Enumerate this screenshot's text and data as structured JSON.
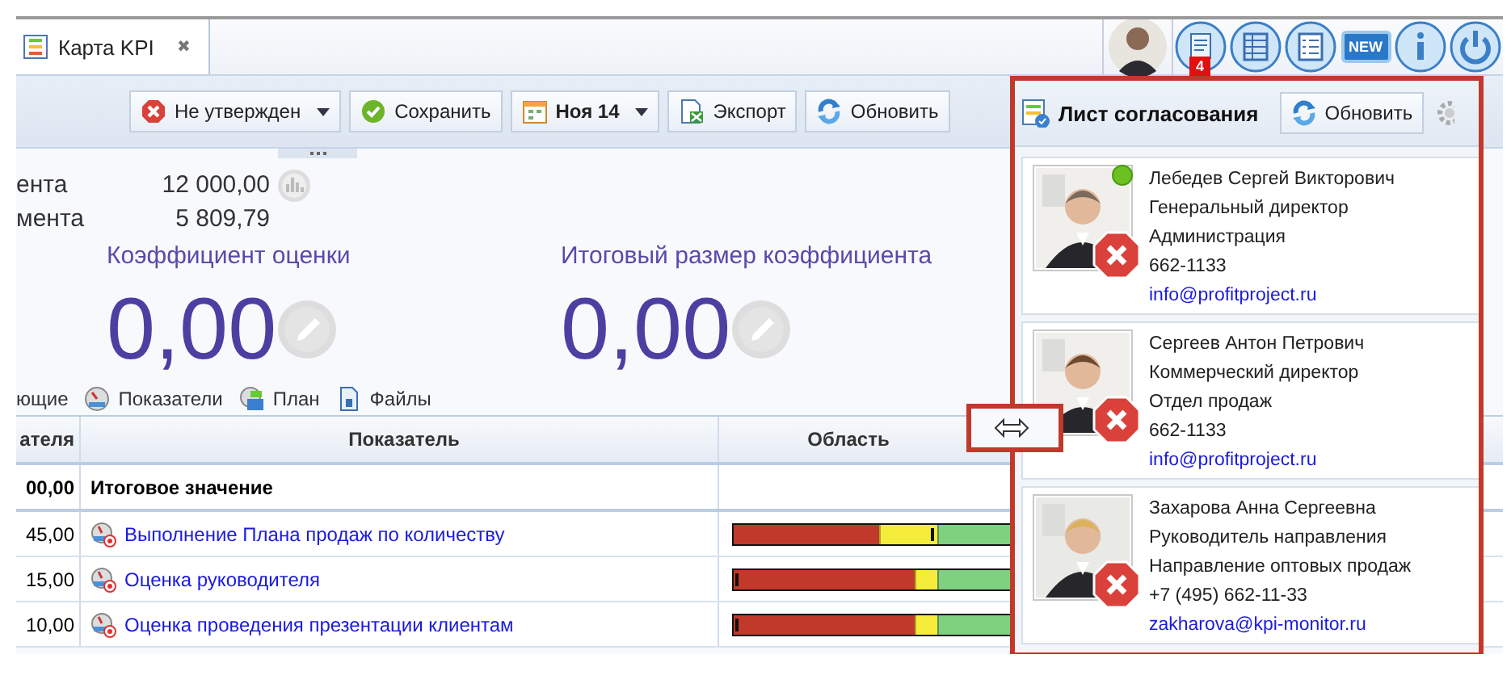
{
  "tab": {
    "label": "Карта KPI",
    "close": "✖",
    "selected": true
  },
  "header_icons": [
    {
      "kind": "avatar"
    },
    {
      "kind": "inbox",
      "badge": "4"
    },
    {
      "kind": "grid"
    },
    {
      "kind": "checklist"
    },
    {
      "kind": "new",
      "label": "NEW"
    },
    {
      "kind": "info"
    },
    {
      "kind": "power"
    }
  ],
  "toolbar": [
    {
      "kind": "rejected",
      "label": "Не утвержден",
      "dropdown": true
    },
    {
      "kind": "ok",
      "label": "Сохранить",
      "dropdown": false
    },
    {
      "kind": "calendar",
      "label": "Ноя 14",
      "dropdown": true
    },
    {
      "kind": "export",
      "label": "Экспорт",
      "dropdown": false
    },
    {
      "kind": "refresh",
      "label": "Обновить",
      "dropdown": false
    }
  ],
  "summary": [
    {
      "label": "ента",
      "value": "12 000,00",
      "chart_icon": true
    },
    {
      "label": "мента",
      "value": "5 809,79",
      "chart_icon": false
    }
  ],
  "scores": [
    {
      "title": "Коэффициент оценки",
      "value": "0,00"
    },
    {
      "title": "Итоговый размер коэффициента",
      "value": "0,00"
    }
  ],
  "sections": [
    {
      "label": "ющие",
      "kind": "none"
    },
    {
      "label": "Показатели",
      "kind": "gauge"
    },
    {
      "label": "План",
      "kind": "plan"
    },
    {
      "label": "Файлы",
      "kind": "file"
    }
  ],
  "table": {
    "columns": [
      "ателя",
      "Показатель",
      "Область"
    ],
    "rows": [
      {
        "kind": "total",
        "weight": "00,00",
        "name": "Итоговое значение"
      },
      {
        "kind": "indicator",
        "weight": "45,00",
        "name": "Выполнение Плана продаж по количеству",
        "marker": {
          "level": 0.61
        },
        "zones": [
          {
            "color": "#c0392b"
          },
          {
            "color": "#f6ec3a"
          },
          {
            "color": "#7fd07f"
          }
        ],
        "thresholds": [
          {
            "level": 0.45
          },
          {
            "level": 0.63
          }
        ]
      },
      {
        "kind": "indicator",
        "weight": "15,00",
        "name": "Оценка руководителя",
        "marker": {
          "level": 0.005
        },
        "zones": [
          {
            "color": "#c0392b"
          },
          {
            "color": "#f6ec3a"
          },
          {
            "color": "#7fd07f"
          }
        ],
        "thresholds": [
          {
            "level": 0.56
          },
          {
            "level": 0.63
          }
        ]
      },
      {
        "kind": "indicator",
        "weight": "10,00",
        "name": "Оценка проведения презентации клиентам",
        "marker": {
          "level": 0.005
        },
        "zones": [
          {
            "color": "#c0392b"
          },
          {
            "color": "#f6ec3a"
          },
          {
            "color": "#7fd07f"
          }
        ],
        "thresholds": [
          {
            "level": 0.56
          },
          {
            "level": 0.63
          }
        ]
      }
    ]
  },
  "approval_panel": {
    "title": "Лист согласования",
    "refresh": "Обновить",
    "approvers": [
      {
        "name": "Лебедев Сергей Викторович",
        "position": "Генеральный директор",
        "department": "Администрация",
        "phone": "662-1133",
        "email": "info@profitproject.ru",
        "online": true,
        "rejected": true
      },
      {
        "name": "Сергеев Антон Петрович",
        "position": "Коммерческий директор",
        "department": "Отдел продаж",
        "phone": "662-1133",
        "email": "info@profitproject.ru",
        "online": false,
        "rejected": true
      },
      {
        "name": "Захарова Анна Сергеевна",
        "position": "Руководитель направления",
        "department": "Направление оптовых продаж",
        "phone": "+7 (495) 662-11-33",
        "email": "zakharova@kpi-monitor.ru",
        "online": false,
        "rejected": true
      }
    ]
  }
}
